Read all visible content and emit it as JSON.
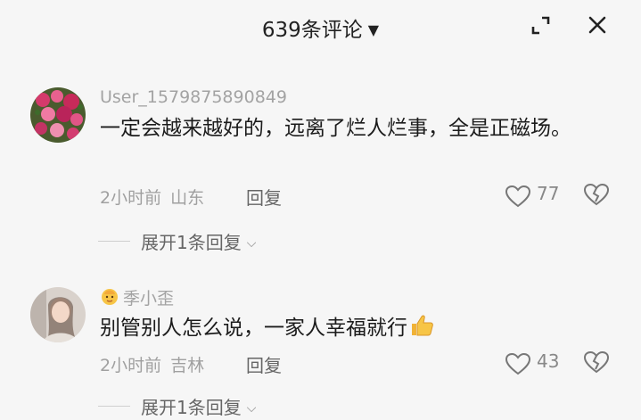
{
  "header": {
    "title": "639条评论",
    "caret": "▼",
    "expand_icon": "fullscreen-corner-icon",
    "close_icon": "close-icon"
  },
  "comments": [
    {
      "username": "User_1579875890849",
      "text": "一定会越来越好的，远离了烂人烂事，全是正磁场。",
      "time": "2小时前",
      "location": "山东",
      "reply_label": "回复",
      "likes": "77",
      "expand_label": "展开1条回复",
      "avatar": "flower-photo"
    },
    {
      "username": "季小歪",
      "text": "别管别人怎么说，一家人幸福就行",
      "time": "2小时前",
      "location": "吉林",
      "reply_label": "回复",
      "likes": "43",
      "expand_label": "展开1条回复",
      "avatar": "woman-portrait",
      "username_emoji": "baby-emoji",
      "text_emoji": "thumbs-up-emoji"
    }
  ]
}
